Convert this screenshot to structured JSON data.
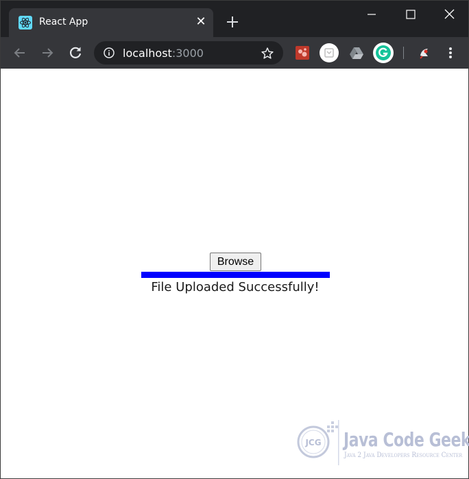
{
  "browser": {
    "tab": {
      "title": "React App",
      "favicon": "react-logo-icon",
      "close_glyph": "✕"
    },
    "new_tab_icon": "plus-icon",
    "window_controls": [
      "minimize-icon",
      "maximize-icon",
      "close-icon"
    ],
    "address_bar": {
      "host": "localhost",
      "port": ":3000",
      "info_icon": "info-icon",
      "bookmark_icon": "star-icon"
    },
    "navigation": [
      "back-arrow-icon",
      "forward-arrow-icon",
      "reload-icon"
    ],
    "extensions": [
      "extension-red-icon",
      "extension-white-icon",
      "google-drive-icon",
      "grammarly-icon",
      "extension-bird-icon"
    ],
    "menu_icon": "more-vertical-icon",
    "colors": {
      "titlebar": "#202124",
      "toolbar": "#35363a",
      "omnibox": "#202124",
      "favicon": "#61dafb",
      "grammarly": "#15c39a"
    }
  },
  "page": {
    "browse_label": "Browse",
    "progress": {
      "percent": 100,
      "color": "#0000ff"
    },
    "status_message": "File Uploaded Successfully!"
  },
  "watermark": {
    "logo_text": "JCG",
    "title": "Java Code Geeks",
    "subtitle": "Java 2 Java Developers Resource Center"
  }
}
